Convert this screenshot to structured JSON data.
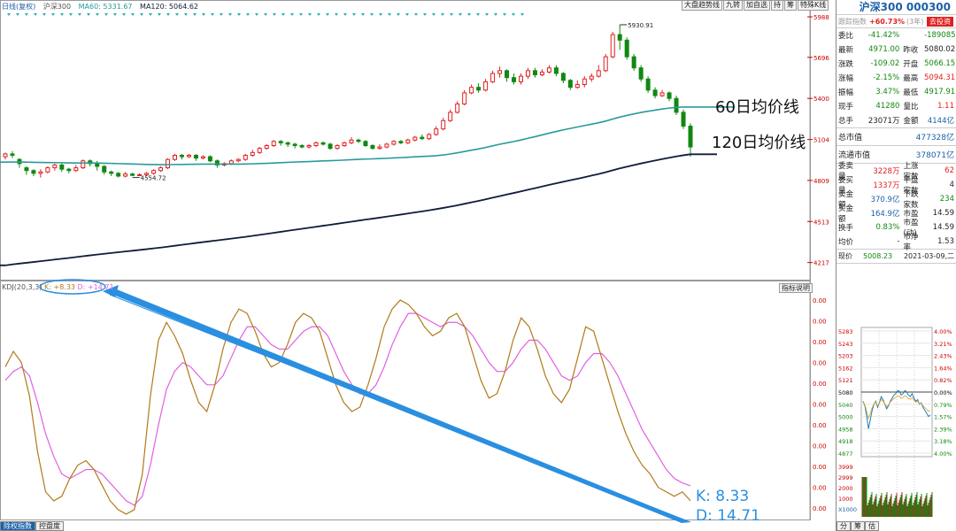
{
  "header": {
    "period_label": "日线(复权)",
    "index_label": "沪深300",
    "ma60_label": "MA60: 5331.67",
    "ma120_label": "MA120: 5064.62",
    "toolbar": [
      "大盘趋势线",
      "九转",
      "加自选",
      "持",
      "筹",
      "特殊K线"
    ]
  },
  "price_axis": [
    "5988",
    "5696",
    "5400",
    "5104",
    "4809",
    "4513",
    "4217"
  ],
  "kdj_axis": [
    "0.00",
    "0.00",
    "0.00",
    "0.00",
    "0.00",
    "0.00",
    "0.00",
    "0.00",
    "0.00",
    "0.00",
    "0.00"
  ],
  "annotations": {
    "peak_label": "5930.91",
    "low_label": "4554.72",
    "ma60_text": "60日均价线",
    "ma120_text": "120日均价线",
    "k_text": "K:  8.33",
    "d_text": "D: 14.71"
  },
  "kdj_header": {
    "label": "KDJ(20,3,3)",
    "k": "K: +8.33",
    "d": "D: +14.71",
    "explain_btn": "指标说明"
  },
  "bottom_tabs": [
    "除权指数",
    "控盘度"
  ],
  "colors": {
    "up": "#e02020",
    "down": "#118811",
    "ma60": "#2a9a9a",
    "ma120": "#101c3a",
    "k_line": "#b07a18",
    "d_line": "#e060e0",
    "arrow": "#2a8fe0"
  },
  "chart_data": {
    "type": "candlestick",
    "ma60_start": 4940,
    "ma120_start": 4190,
    "candles": [
      [
        4980,
        5000,
        4960,
        5010
      ],
      [
        5000,
        4990,
        4970,
        5020
      ],
      [
        4960,
        4930,
        4900,
        4970
      ],
      [
        4900,
        4880,
        4850,
        4910
      ],
      [
        4880,
        4860,
        4840,
        4890
      ],
      [
        4860,
        4870,
        4830,
        4890
      ],
      [
        4870,
        4900,
        4860,
        4910
      ],
      [
        4900,
        4920,
        4880,
        4930
      ],
      [
        4920,
        4890,
        4870,
        4940
      ],
      [
        4890,
        4880,
        4860,
        4900
      ],
      [
        4880,
        4900,
        4870,
        4920
      ],
      [
        4900,
        4950,
        4890,
        4960
      ],
      [
        4950,
        4930,
        4910,
        4960
      ],
      [
        4930,
        4910,
        4880,
        4950
      ],
      [
        4910,
        4870,
        4850,
        4920
      ],
      [
        4870,
        4860,
        4840,
        4880
      ],
      [
        4860,
        4840,
        4830,
        4870
      ],
      [
        4840,
        4855,
        4830,
        4870
      ],
      [
        4855,
        4845,
        4840,
        4865
      ],
      [
        4845,
        4850,
        4840,
        4860
      ],
      [
        4850,
        4860,
        4840,
        4870
      ],
      [
        4860,
        4880,
        4850,
        4890
      ],
      [
        4880,
        4900,
        4870,
        4910
      ],
      [
        4900,
        4960,
        4890,
        4970
      ],
      [
        4960,
        4990,
        4950,
        5000
      ],
      [
        4990,
        4980,
        4960,
        5000
      ],
      [
        4980,
        4990,
        4970,
        5000
      ],
      [
        4990,
        4970,
        4950,
        5000
      ],
      [
        4970,
        4980,
        4960,
        4990
      ],
      [
        4980,
        4950,
        4940,
        4990
      ],
      [
        4950,
        4920,
        4900,
        4960
      ],
      [
        4920,
        4930,
        4910,
        4940
      ],
      [
        4930,
        4950,
        4920,
        4960
      ],
      [
        4950,
        4960,
        4940,
        4970
      ],
      [
        4960,
        4990,
        4950,
        5000
      ],
      [
        4990,
        5010,
        4980,
        5030
      ],
      [
        5010,
        5040,
        5000,
        5050
      ],
      [
        5040,
        5060,
        5030,
        5070
      ],
      [
        5060,
        5090,
        5050,
        5100
      ],
      [
        5090,
        5080,
        5060,
        5100
      ],
      [
        5080,
        5070,
        5050,
        5090
      ],
      [
        5070,
        5060,
        5040,
        5080
      ],
      [
        5060,
        5050,
        5040,
        5070
      ],
      [
        5050,
        5060,
        5040,
        5070
      ],
      [
        5060,
        5080,
        5050,
        5090
      ],
      [
        5080,
        5070,
        5060,
        5090
      ],
      [
        5070,
        5040,
        5030,
        5080
      ],
      [
        5040,
        5060,
        5030,
        5070
      ],
      [
        5060,
        5080,
        5050,
        5090
      ],
      [
        5080,
        5100,
        5070,
        5120
      ],
      [
        5100,
        5090,
        5080,
        5110
      ],
      [
        5090,
        5060,
        5050,
        5100
      ],
      [
        5060,
        5040,
        5030,
        5070
      ],
      [
        5040,
        5050,
        5030,
        5070
      ],
      [
        5050,
        5070,
        5040,
        5080
      ],
      [
        5070,
        5090,
        5060,
        5100
      ],
      [
        5090,
        5080,
        5070,
        5100
      ],
      [
        5080,
        5100,
        5070,
        5110
      ],
      [
        5100,
        5120,
        5090,
        5130
      ],
      [
        5120,
        5110,
        5100,
        5140
      ],
      [
        5110,
        5140,
        5100,
        5150
      ],
      [
        5140,
        5180,
        5130,
        5200
      ],
      [
        5180,
        5240,
        5170,
        5260
      ],
      [
        5240,
        5300,
        5230,
        5320
      ],
      [
        5300,
        5360,
        5290,
        5380
      ],
      [
        5360,
        5440,
        5350,
        5460
      ],
      [
        5440,
        5480,
        5430,
        5500
      ],
      [
        5480,
        5460,
        5440,
        5510
      ],
      [
        5460,
        5520,
        5450,
        5540
      ],
      [
        5520,
        5580,
        5510,
        5600
      ],
      [
        5580,
        5600,
        5550,
        5630
      ],
      [
        5600,
        5550,
        5520,
        5610
      ],
      [
        5550,
        5520,
        5500,
        5580
      ],
      [
        5520,
        5560,
        5500,
        5580
      ],
      [
        5560,
        5600,
        5540,
        5620
      ],
      [
        5600,
        5570,
        5550,
        5620
      ],
      [
        5570,
        5590,
        5560,
        5610
      ],
      [
        5590,
        5620,
        5580,
        5640
      ],
      [
        5620,
        5580,
        5560,
        5640
      ],
      [
        5580,
        5530,
        5510,
        5590
      ],
      [
        5530,
        5480,
        5460,
        5540
      ],
      [
        5480,
        5500,
        5470,
        5530
      ],
      [
        5500,
        5540,
        5480,
        5560
      ],
      [
        5540,
        5560,
        5520,
        5580
      ],
      [
        5560,
        5600,
        5550,
        5640
      ],
      [
        5600,
        5700,
        5590,
        5720
      ],
      [
        5700,
        5860,
        5690,
        5880
      ],
      [
        5860,
        5820,
        5750,
        5931
      ],
      [
        5820,
        5700,
        5680,
        5840
      ],
      [
        5700,
        5620,
        5600,
        5720
      ],
      [
        5620,
        5540,
        5520,
        5640
      ],
      [
        5540,
        5460,
        5440,
        5560
      ],
      [
        5460,
        5420,
        5400,
        5480
      ],
      [
        5420,
        5440,
        5410,
        5460
      ],
      [
        5440,
        5400,
        5380,
        5450
      ],
      [
        5400,
        5300,
        5280,
        5420
      ],
      [
        5300,
        5200,
        5180,
        5320
      ],
      [
        5200,
        5050,
        4980,
        5220
      ]
    ],
    "kdj_k": [
      68,
      75,
      70,
      55,
      30,
      12,
      8,
      10,
      18,
      24,
      26,
      22,
      15,
      8,
      4,
      2,
      4,
      20,
      55,
      80,
      88,
      82,
      74,
      62,
      52,
      48,
      60,
      76,
      88,
      94,
      92,
      84,
      74,
      68,
      70,
      78,
      88,
      92,
      90,
      84,
      72,
      60,
      52,
      48,
      50,
      60,
      72,
      86,
      94,
      98,
      96,
      92,
      86,
      82,
      84,
      90,
      92,
      86,
      74,
      62,
      54,
      56,
      66,
      80,
      90,
      86,
      76,
      64,
      56,
      52,
      58,
      72,
      86,
      84,
      72,
      60,
      48,
      38,
      30,
      24,
      20,
      14,
      12,
      10,
      12,
      8
    ],
    "kdj_d": [
      62,
      66,
      68,
      64,
      52,
      38,
      28,
      20,
      18,
      20,
      22,
      22,
      20,
      16,
      12,
      8,
      6,
      10,
      24,
      42,
      58,
      66,
      70,
      68,
      64,
      60,
      60,
      64,
      72,
      80,
      86,
      86,
      82,
      78,
      76,
      76,
      80,
      84,
      86,
      86,
      82,
      74,
      66,
      60,
      56,
      56,
      60,
      68,
      78,
      86,
      92,
      92,
      90,
      88,
      86,
      88,
      88,
      86,
      82,
      76,
      70,
      66,
      66,
      70,
      76,
      80,
      80,
      76,
      70,
      64,
      62,
      64,
      70,
      74,
      74,
      70,
      64,
      56,
      48,
      40,
      34,
      28,
      22,
      18,
      16,
      14.71
    ]
  },
  "right_panel": {
    "title": "沪深300 000300",
    "sub_label": "跟踪指数",
    "sub_value": "+60.73%",
    "sub_period": "(3年)",
    "sub_btn": "去投资",
    "rows": [
      {
        "l1": "委比",
        "v1": "-41.42%",
        "c1": "green",
        "l2": "",
        "v2": "-18908564",
        "c2": "green"
      },
      {
        "l1": "最新",
        "v1": "4971.00",
        "c1": "green",
        "l2": "昨收",
        "v2": "5080.02",
        "c2": ""
      },
      {
        "l1": "涨跌",
        "v1": "-109.02",
        "c1": "green",
        "l2": "开盘",
        "v2": "5066.15",
        "c2": "green"
      },
      {
        "l1": "涨幅",
        "v1": "-2.15%",
        "c1": "green",
        "l2": "最高",
        "v2": "5094.31",
        "c2": "red"
      },
      {
        "l1": "振幅",
        "v1": "3.47%",
        "c1": "green",
        "l2": "最低",
        "v2": "4917.91",
        "c2": "green"
      },
      {
        "l1": "现手",
        "v1": "41280",
        "c1": "green",
        "l2": "量比",
        "v2": "1.11",
        "c2": "red"
      },
      {
        "l1": "总手",
        "v1": "23071万",
        "c1": "",
        "l2": "金额",
        "v2": "4144亿",
        "c2": "blue"
      }
    ],
    "market_cap": {
      "label": "总市值",
      "value": "477328亿"
    },
    "float_cap": {
      "label": "流通市值",
      "value": "378071亿"
    },
    "rows2": [
      {
        "l1": "委卖量",
        "v1": "3228万",
        "c1": "red",
        "l2": "上涨家数",
        "v2": "62",
        "c2": "red"
      },
      {
        "l1": "委买量",
        "v1": "1337万",
        "c1": "red",
        "l2": "平盘家数",
        "v2": "4",
        "c2": ""
      },
      {
        "l1": "卖金额",
        "v1": "370.9亿",
        "c1": "blue",
        "l2": "下跌家数",
        "v2": "234",
        "c2": "green"
      },
      {
        "l1": "买金额",
        "v1": "164.9亿",
        "c1": "blue",
        "l2": "市盈",
        "v2": "14.59",
        "c2": ""
      },
      {
        "l1": "换手",
        "v1": "0.83%",
        "c1": "green",
        "l2": "市盈(动)",
        "v2": "14.59",
        "c2": ""
      },
      {
        "l1": "均价",
        "v1": "-",
        "c1": "",
        "l2": "市净率",
        "v2": "1.53",
        "c2": ""
      }
    ],
    "mini": {
      "label": "现价",
      "value": "5008.23",
      "date": "2021-03-09,二",
      "left_axis": [
        "5283",
        "5243",
        "5203",
        "5162",
        "5121",
        "5080",
        "5040",
        "5000",
        "4958",
        "4918",
        "4877"
      ],
      "right_axis": [
        "4.00%",
        "3.21%",
        "2.43%",
        "1.64%",
        "0.82%",
        "0.00%",
        "0.79%",
        "1.57%",
        "2.39%",
        "3.18%",
        "4.00%"
      ],
      "vol_axis": [
        "3999",
        "2999",
        "2000",
        "1000",
        "X1000"
      ],
      "tabs": [
        "分",
        "筹",
        "估"
      ]
    }
  }
}
